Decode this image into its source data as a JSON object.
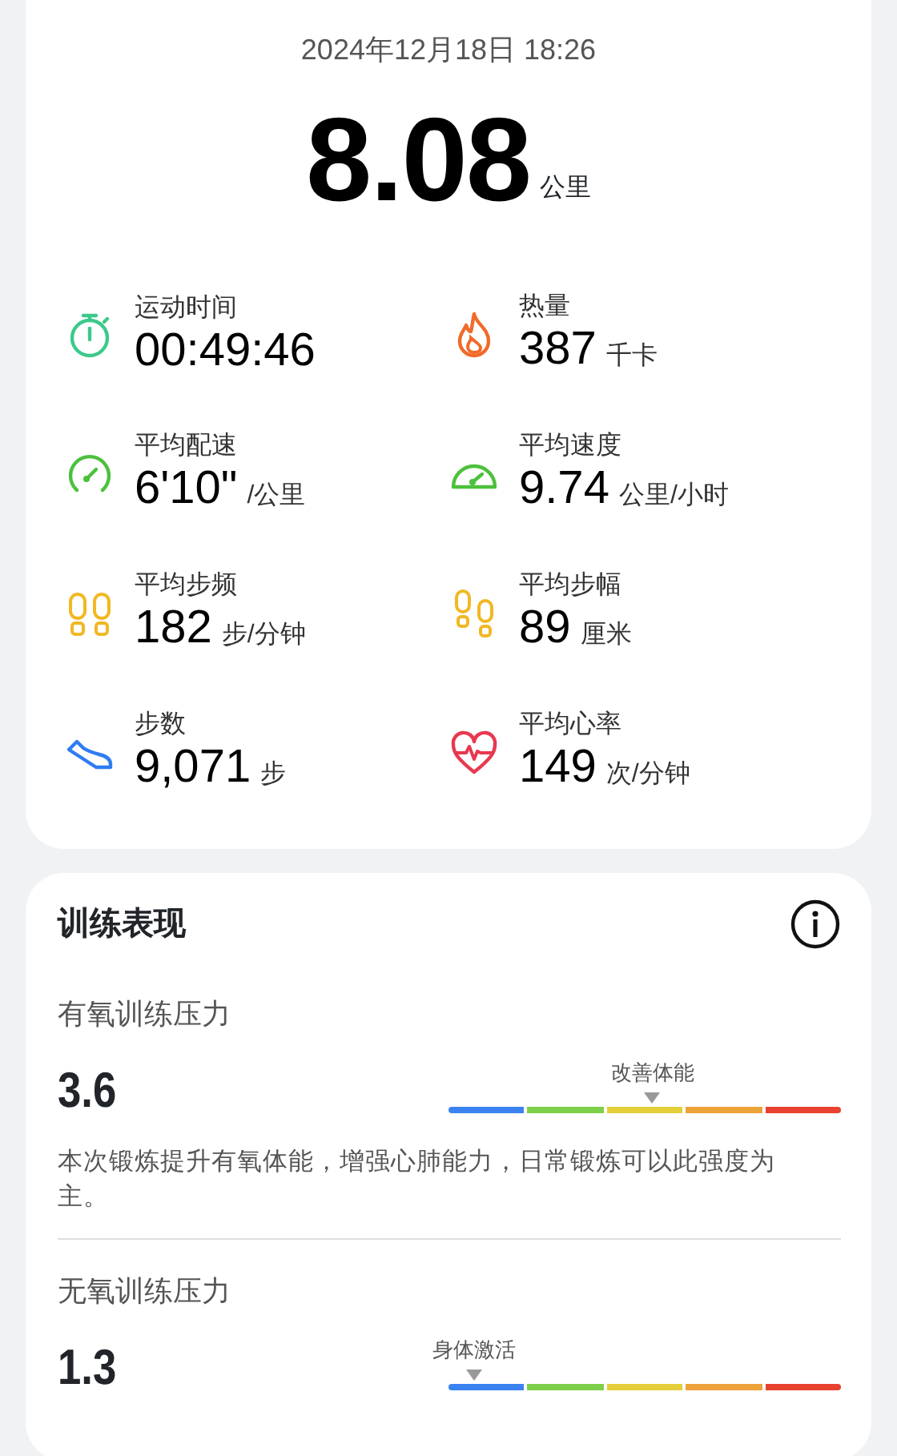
{
  "summary": {
    "datetime": "2024年12月18日  18:26",
    "distance": "8.08",
    "distance_unit": "公里",
    "stats": [
      {
        "kind": "stopwatch",
        "color": "#3cc98a",
        "label": "运动时间",
        "value": "00:49:46"
      },
      {
        "kind": "flame",
        "color": "#f06a2a",
        "label": "热量",
        "value": "387",
        "unit": "千卡"
      },
      {
        "kind": "gauge",
        "color": "#4cc13c",
        "label": "平均配速",
        "value": "6'10\"",
        "unit": "/公里"
      },
      {
        "kind": "speedometer",
        "color": "#4cc13c",
        "label": "平均速度",
        "value": "9.74",
        "unit": "公里/小时"
      },
      {
        "kind": "footprints",
        "color": "#f1b823",
        "label": "平均步频",
        "value": "182",
        "unit": "步/分钟"
      },
      {
        "kind": "steps",
        "color": "#f1b823",
        "label": "平均步幅",
        "value": "89",
        "unit": "厘米"
      },
      {
        "kind": "shoe",
        "color": "#2f7cf0",
        "label": "步数",
        "value": "9,071",
        "unit": "步"
      },
      {
        "kind": "heart",
        "color": "#e8384f",
        "label": "平均心率",
        "value": "149",
        "unit": "次/分钟"
      }
    ]
  },
  "performance": {
    "title": "训练表现",
    "metrics": [
      {
        "label": "有氧训练压力",
        "value": "3.6",
        "marker_label": "改善体能",
        "level": 0.52,
        "description": "本次锻炼提升有氧体能，增强心肺能力，日常锻炼可以此强度为主。"
      },
      {
        "label": "无氧训练压力",
        "value": "1.3",
        "marker_label": "身体激活",
        "level": 0.065
      }
    ]
  }
}
